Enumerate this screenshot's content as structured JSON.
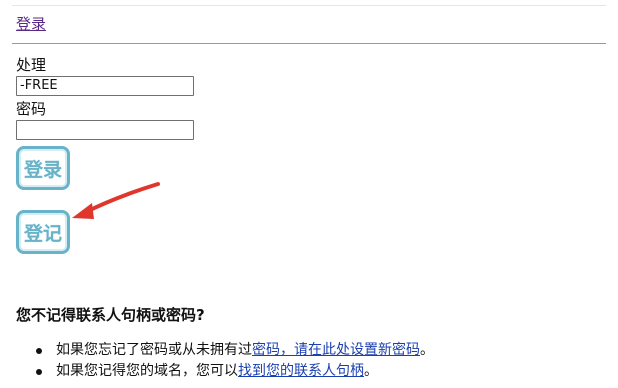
{
  "header": {
    "login_link": "登录"
  },
  "form": {
    "handle_label": "处理",
    "handle_value": "-FREE",
    "password_label": "密码",
    "password_value": "",
    "login_button": "登录",
    "register_button": "登记"
  },
  "annotation": {
    "arrow_color": "#e0362c",
    "points_to": "register-button"
  },
  "help": {
    "heading": "您不记得联系人句柄或密码?",
    "items": [
      {
        "text_before": "如果您忘记了密码或从未拥有过",
        "link": "密码，请在此处设置新密码",
        "text_after": "。"
      },
      {
        "text_before": "如果您记得您的域名，您可以",
        "link": "找到您的联系人句柄",
        "text_after": "。"
      }
    ]
  },
  "colors": {
    "button_accent": "#69b3c9",
    "link_visited": "#5b2a86",
    "link": "#1a3fb0"
  }
}
